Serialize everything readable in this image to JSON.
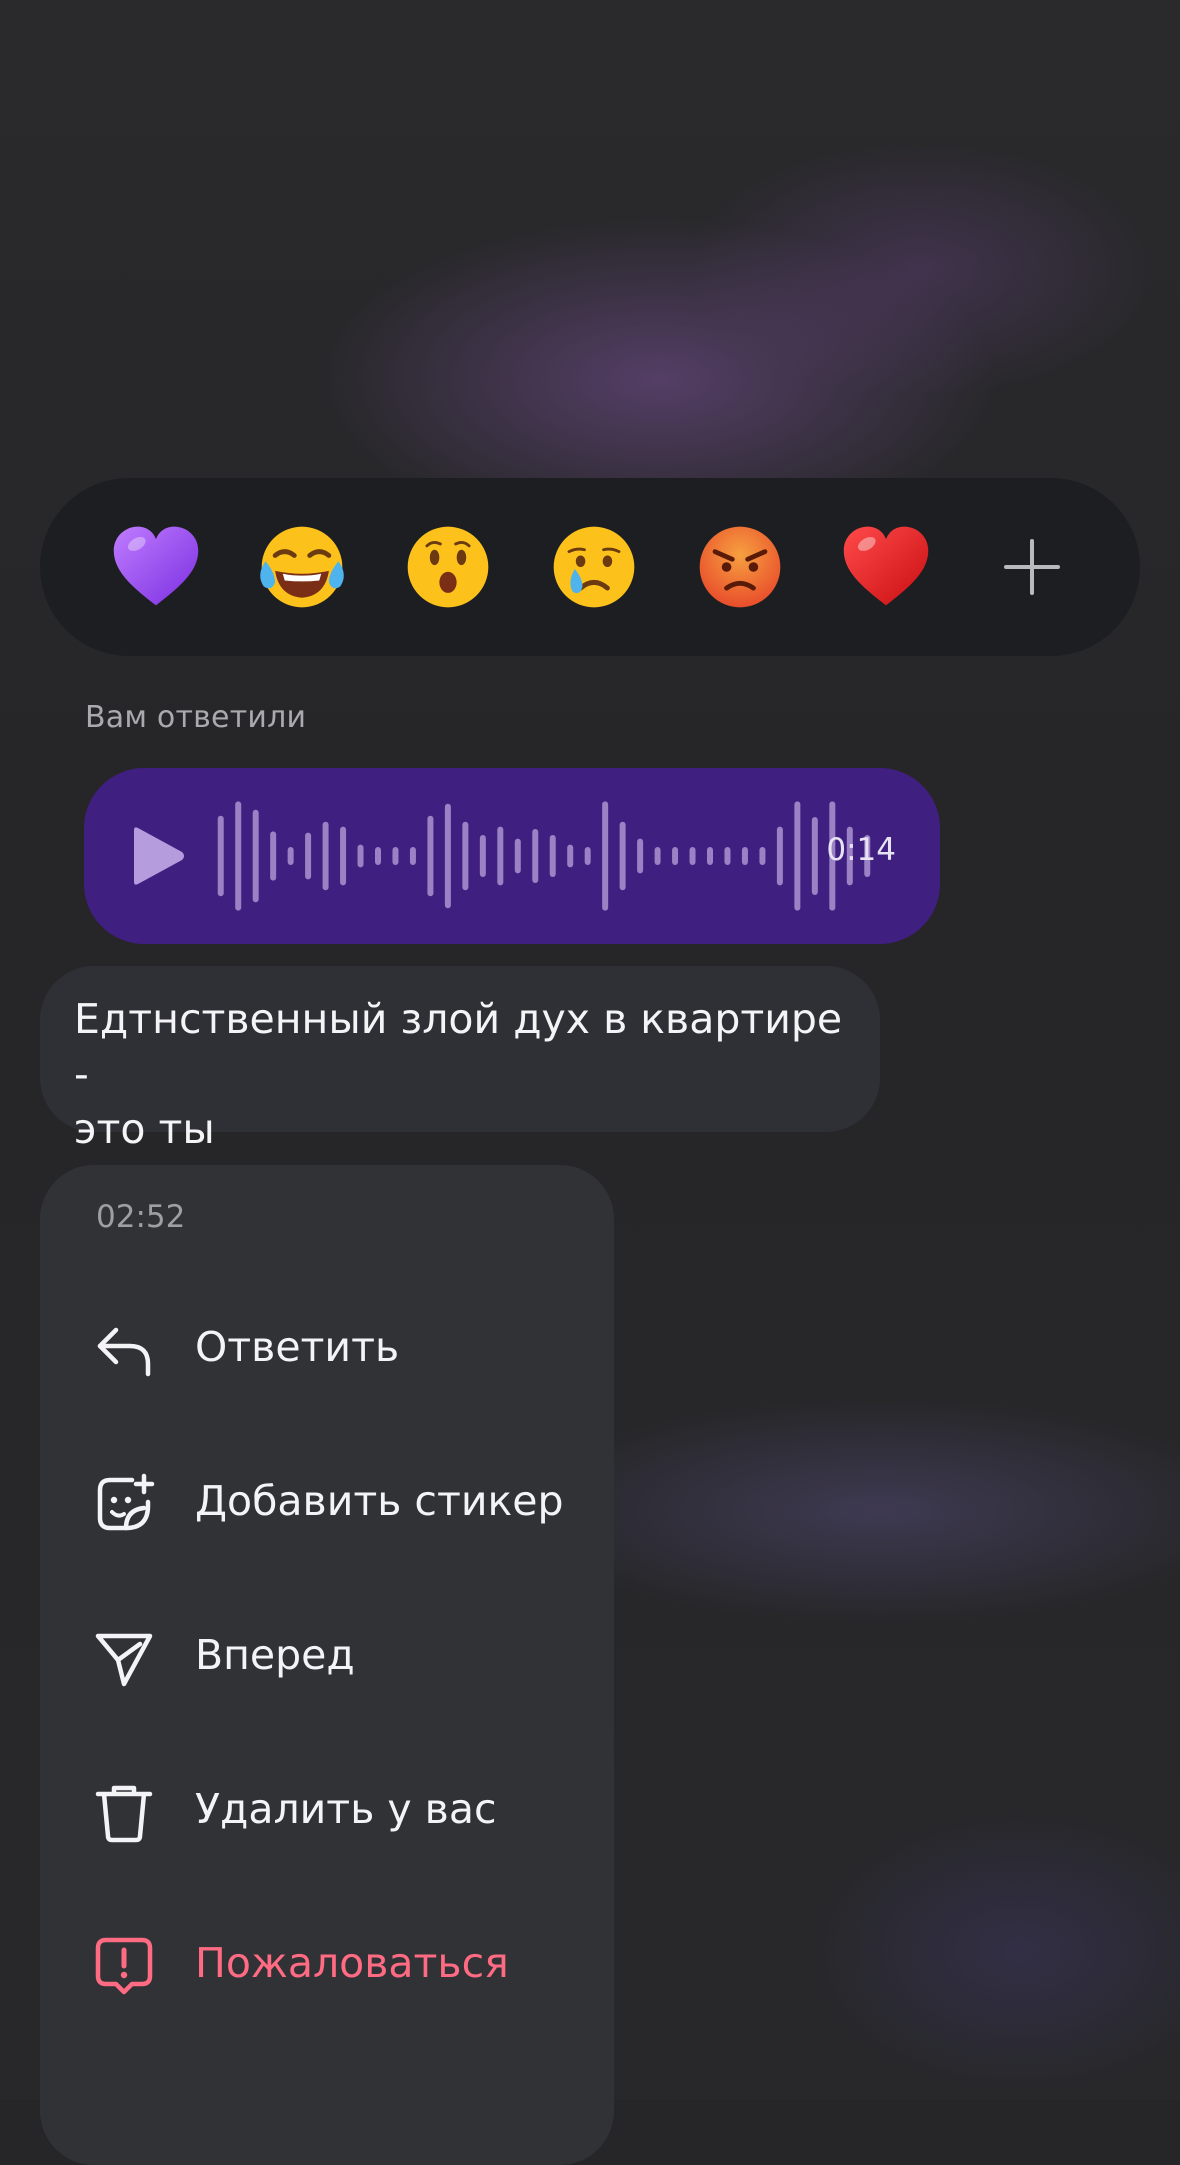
{
  "reactions": {
    "items": [
      {
        "name": "purple-heart"
      },
      {
        "name": "face-with-tears-of-joy"
      },
      {
        "name": "surprised-face"
      },
      {
        "name": "crying-face"
      },
      {
        "name": "angry-face"
      },
      {
        "name": "red-heart"
      }
    ],
    "add_icon": "plus-icon"
  },
  "reply_label": "Вам ответили",
  "voice_message": {
    "duration": "0:14",
    "color": "#3f1f80",
    "waveform": [
      0.62,
      0.86,
      0.72,
      0.36,
      0.1,
      0.34,
      0.52,
      0.44,
      0.14,
      0.1,
      0.1,
      0.1,
      0.62,
      0.82,
      0.52,
      0.3,
      0.44,
      0.24,
      0.4,
      0.3,
      0.14,
      0.1,
      0.86,
      0.52,
      0.24,
      0.1,
      0.1,
      0.1,
      0.1,
      0.1,
      0.1,
      0.1,
      0.44,
      0.86,
      0.6,
      0.86,
      0.44,
      0.3
    ]
  },
  "text_message": "Едтнственный злой дух в квартире -\nэто ты",
  "menu": {
    "time": "02:52",
    "items": [
      {
        "label": "Ответить",
        "icon": "reply-icon"
      },
      {
        "label": "Добавить стикер",
        "icon": "sticker-add-icon"
      },
      {
        "label": "Вперед",
        "icon": "forward-icon"
      },
      {
        "label": "Удалить у вас",
        "icon": "trash-icon"
      },
      {
        "label": "Пожаловаться",
        "icon": "report-icon",
        "danger": true,
        "color": "#ff6b82"
      }
    ]
  }
}
